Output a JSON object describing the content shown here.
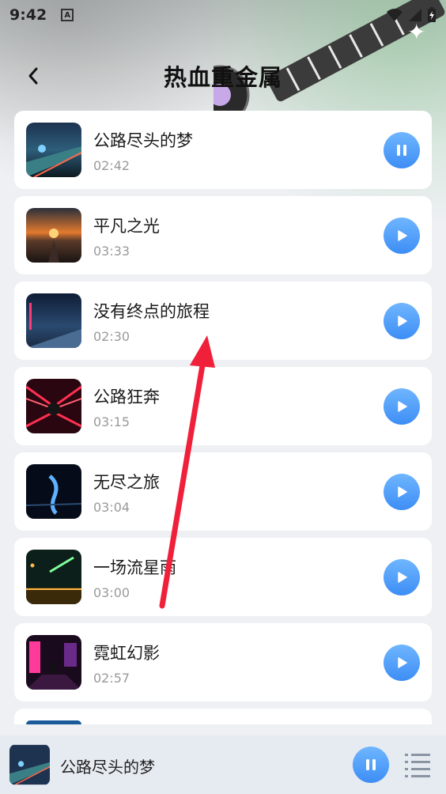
{
  "status_bar": {
    "time": "9:42",
    "a_icon": "A"
  },
  "header": {
    "title": "热血重金属"
  },
  "songs": [
    {
      "title": "公路尽头的梦",
      "duration": "02:42",
      "state": "pause"
    },
    {
      "title": "平凡之光",
      "duration": "03:33",
      "state": "play"
    },
    {
      "title": "没有终点的旅程",
      "duration": "02:30",
      "state": "play"
    },
    {
      "title": "公路狂奔",
      "duration": "03:15",
      "state": "play"
    },
    {
      "title": "无尽之旅",
      "duration": "03:04",
      "state": "play"
    },
    {
      "title": "一场流星雨",
      "duration": "03:00",
      "state": "play"
    },
    {
      "title": "霓虹幻影",
      "duration": "02:57",
      "state": "play"
    }
  ],
  "player": {
    "title": "公路尽头的梦",
    "state": "pause"
  },
  "colors": {
    "accent": "#4a9bf7",
    "background": "#eef0f3",
    "annotation_arrow": "#f0203a"
  }
}
